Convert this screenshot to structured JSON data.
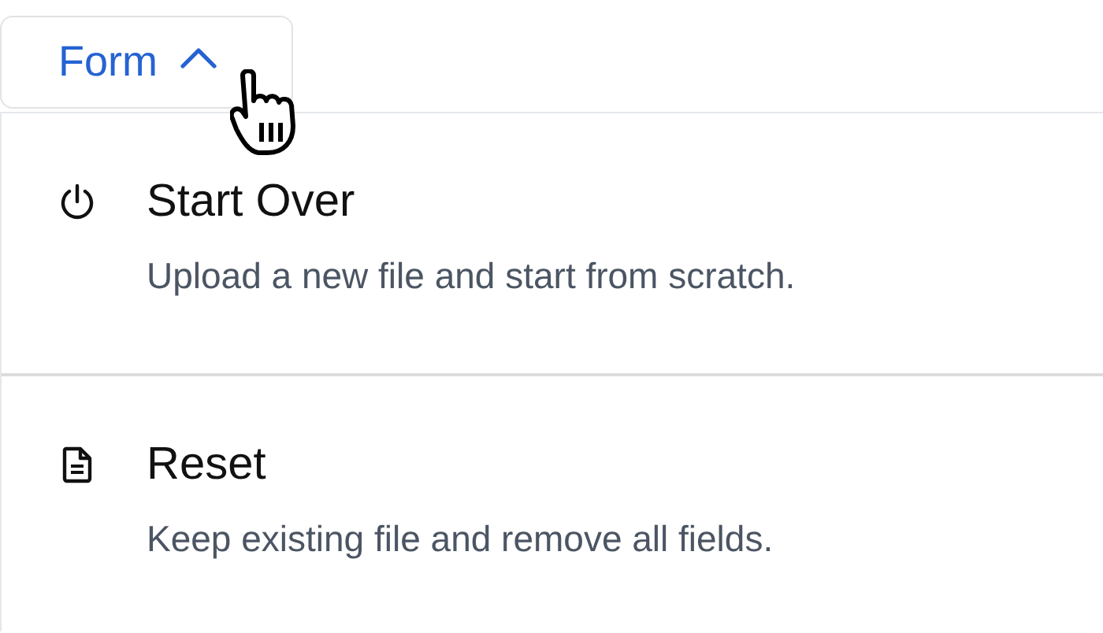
{
  "dropdown": {
    "label": "Form",
    "expanded": true
  },
  "menu_items": [
    {
      "kind": "power",
      "title": "Start Over",
      "description": "Upload a new file and start from scratch."
    },
    {
      "kind": "document",
      "title": "Reset",
      "description": "Keep existing file and remove all fields."
    }
  ]
}
